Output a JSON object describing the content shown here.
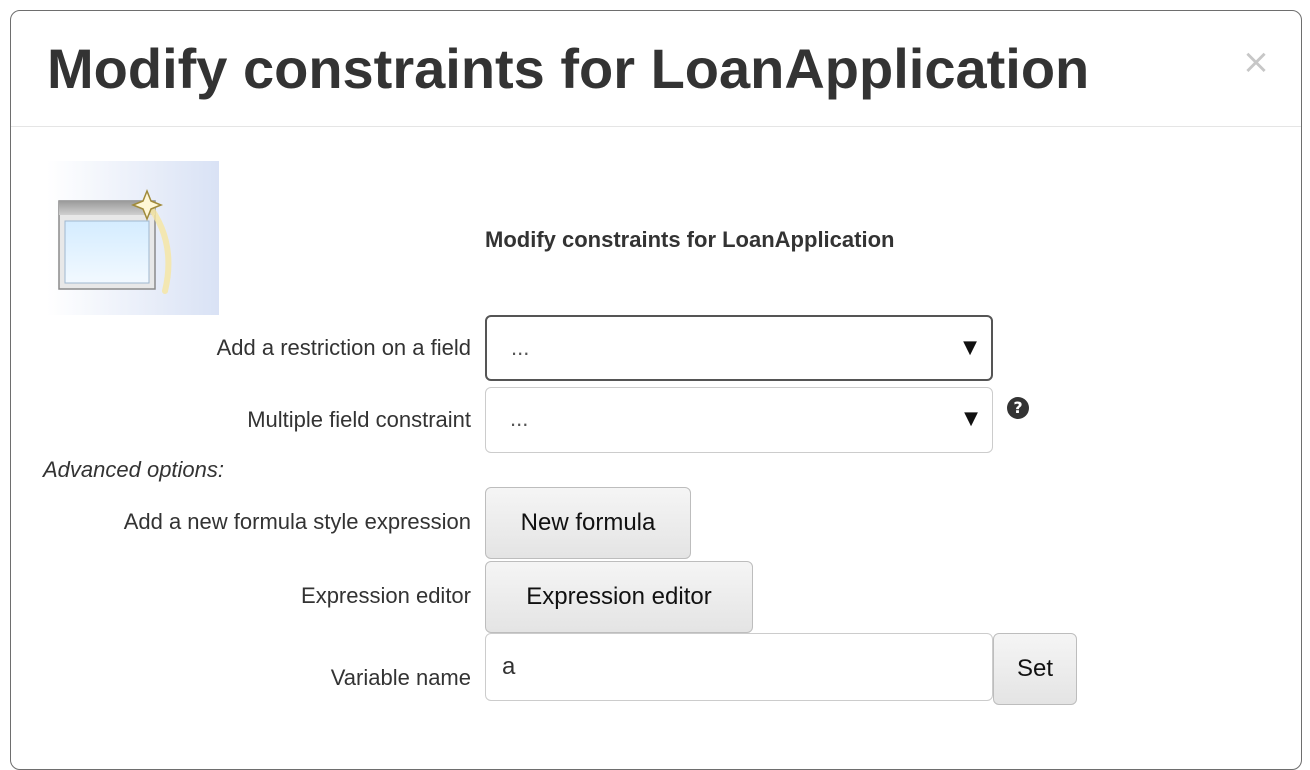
{
  "dialog": {
    "title": "Modify constraints for LoanApplication",
    "close_glyph": "×",
    "subtitle": "Modify constraints for LoanApplication",
    "icon": "wizard-window-icon"
  },
  "rows": {
    "restriction": {
      "label": "Add a restriction on a field",
      "value": "..."
    },
    "multiple": {
      "label": "Multiple field constraint",
      "value": "...",
      "help_glyph": "?"
    },
    "advanced_label": "Advanced options:",
    "formula": {
      "label": "Add a new formula style expression",
      "button": "New formula"
    },
    "expression": {
      "label": "Expression editor",
      "button": "Expression editor"
    },
    "variable": {
      "label": "Variable name",
      "value": "a",
      "button": "Set"
    }
  },
  "colors": {
    "text": "#333333",
    "border": "#cccccc",
    "button_bg": "#eeeeee"
  }
}
